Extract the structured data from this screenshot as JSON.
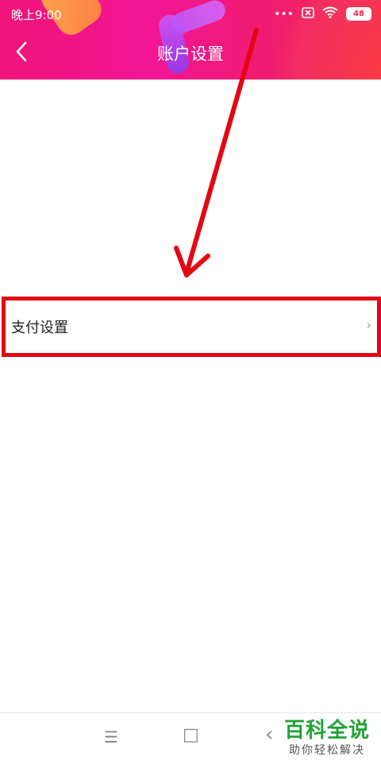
{
  "status_bar": {
    "time": "晚上9:00",
    "icons": [
      "more-dots-icon",
      "sim-x-icon",
      "wifi-icon"
    ],
    "battery": "48"
  },
  "header": {
    "title": "账户设置",
    "back_icon": "chevron-left-icon"
  },
  "settings": {
    "items": [
      {
        "label": "支付设置",
        "icon": "chevron-right-icon"
      }
    ]
  },
  "annotation": {
    "color": "#e30613"
  },
  "nav_bar": {
    "menu_glyph": "☰",
    "home_glyph": "□",
    "back_glyph": "‹"
  },
  "watermark": {
    "main": "百科全说",
    "sub": "助你轻松解决"
  }
}
